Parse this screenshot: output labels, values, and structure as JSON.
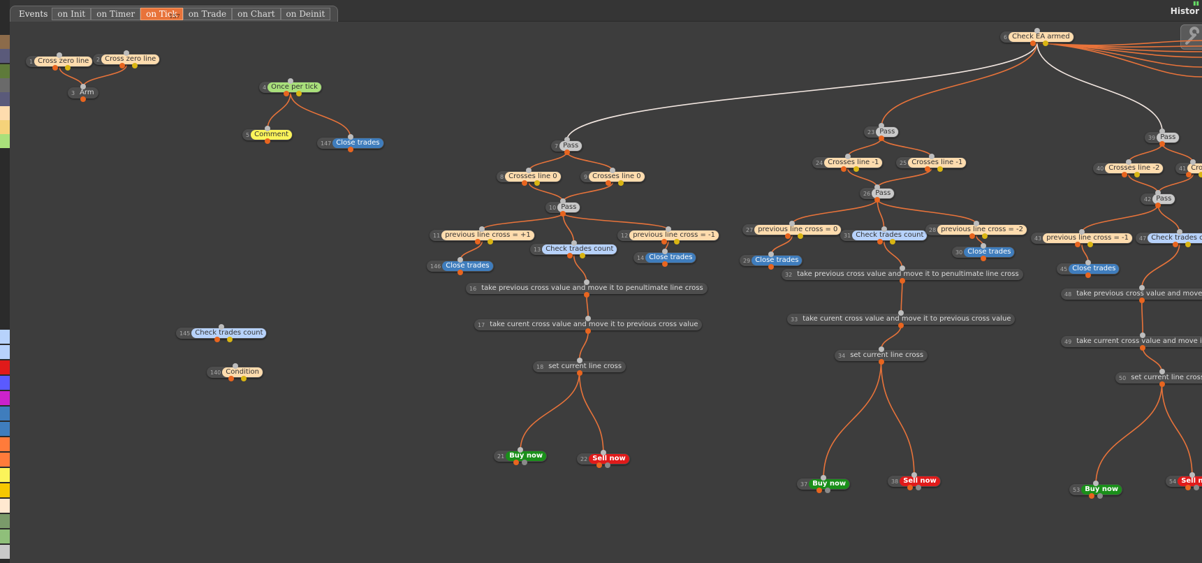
{
  "tabs": {
    "events_label": "Events",
    "items": [
      {
        "label": "on Init",
        "active": false
      },
      {
        "label": "on Timer",
        "active": false
      },
      {
        "label": "on Tick",
        "active": true,
        "badge": "157"
      },
      {
        "label": "on Trade",
        "active": false
      },
      {
        "label": "on Chart",
        "active": false
      },
      {
        "label": "on Deinit",
        "active": false
      }
    ]
  },
  "history_label": "Histor",
  "colors": {
    "link_orange": "#e8733a",
    "link_white": "#f2e6e0",
    "peach": "#fedcae",
    "blue": "#3f7dbd",
    "light_blue": "#b7d2fb",
    "green": "#a9e07b",
    "yellow": "#fbf45a",
    "buy": "#1a8f1a",
    "sell": "#e01a1a"
  },
  "palette": [
    "#8c6b4a",
    "#5a5a7a",
    "#5e7a3a",
    "#6a6a6a",
    "#5a5a7a",
    "#fedcae",
    "#f5d27a",
    "#a9e07b",
    "#b7d2fb",
    "#b7d2fb",
    "#e01a1a",
    "#5a5aff",
    "#cc22cc",
    "#3f7dbd",
    "#3f7dbd",
    "#ff7b3a",
    "#ff7b3a",
    "#fbf45a",
    "#f5c800",
    "#ffe8d0",
    "#7a9a6a",
    "#8fbf7a",
    "#c9c9c9"
  ],
  "nodes": [
    {
      "id": "1",
      "label": "Cross zero line",
      "type": "peach"
    },
    {
      "id": "2",
      "label": "Cross zero line",
      "type": "peach"
    },
    {
      "id": "3",
      "label": "Arm",
      "type": "darkgray"
    },
    {
      "id": "4",
      "label": "Once per tick",
      "type": "green"
    },
    {
      "id": "5",
      "label": "Comment",
      "type": "yellow"
    },
    {
      "id": "147",
      "label": "Close trades",
      "type": "blue"
    },
    {
      "id": "145",
      "label": "Check trades count",
      "type": "lightblue"
    },
    {
      "id": "140",
      "label": "Condition",
      "type": "peach"
    },
    {
      "id": "6",
      "label": "Check EA armed",
      "type": "peach"
    },
    {
      "id": "7",
      "label": "Pass",
      "type": "gray"
    },
    {
      "id": "8",
      "label": "Crosses line 0",
      "type": "peach"
    },
    {
      "id": "9",
      "label": "Crosses line 0",
      "type": "peach"
    },
    {
      "id": "10",
      "label": "Pass",
      "type": "gray"
    },
    {
      "id": "11",
      "label": "previous line cross = +1",
      "type": "peach"
    },
    {
      "id": "13",
      "label": "Check trades count",
      "type": "lightblue"
    },
    {
      "id": "12",
      "label": "previous line cross = -1",
      "type": "peach"
    },
    {
      "id": "146",
      "label": "Close trades",
      "type": "blue"
    },
    {
      "id": "14",
      "label": "Close trades",
      "type": "blue"
    },
    {
      "id": "16",
      "label": "take previous cross value and move it to penultimate line cross",
      "type": "darkgray"
    },
    {
      "id": "17",
      "label": "take curent cross value and move it to previous cross value",
      "type": "darkgray"
    },
    {
      "id": "18",
      "label": "set current line cross",
      "type": "darkgray"
    },
    {
      "id": "21",
      "label": "Buy now",
      "type": "buy"
    },
    {
      "id": "22",
      "label": "Sell now",
      "type": "sell"
    },
    {
      "id": "23",
      "label": "Pass",
      "type": "gray"
    },
    {
      "id": "24",
      "label": "Crosses line -1",
      "type": "peach"
    },
    {
      "id": "25",
      "label": "Crosses line -1",
      "type": "peach"
    },
    {
      "id": "26",
      "label": "Pass",
      "type": "gray"
    },
    {
      "id": "27",
      "label": "previous line cross = 0",
      "type": "peach"
    },
    {
      "id": "31",
      "label": "Check trades count",
      "type": "lightblue"
    },
    {
      "id": "28",
      "label": "previous line cross = -2",
      "type": "peach"
    },
    {
      "id": "29",
      "label": "Close trades",
      "type": "blue"
    },
    {
      "id": "30",
      "label": "Close trades",
      "type": "blue"
    },
    {
      "id": "32",
      "label": "take previous cross value and move it to penultimate line cross",
      "type": "darkgray"
    },
    {
      "id": "33",
      "label": "take curent cross value and move it to previous cross value",
      "type": "darkgray"
    },
    {
      "id": "34",
      "label": "set current line cross",
      "type": "darkgray"
    },
    {
      "id": "37",
      "label": "Buy now",
      "type": "buy"
    },
    {
      "id": "38",
      "label": "Sell now",
      "type": "sell"
    },
    {
      "id": "39",
      "label": "Pass",
      "type": "gray"
    },
    {
      "id": "40",
      "label": "Crosses line -2",
      "type": "peach"
    },
    {
      "id": "41",
      "label": "Cros",
      "type": "peach"
    },
    {
      "id": "42",
      "label": "Pass",
      "type": "gray"
    },
    {
      "id": "43",
      "label": "previous line cross = -1",
      "type": "peach"
    },
    {
      "id": "47",
      "label": "Check trades count",
      "type": "lightblue"
    },
    {
      "id": "45",
      "label": "Close trades",
      "type": "blue"
    },
    {
      "id": "48",
      "label": "take previous cross value and move it to",
      "type": "darkgray"
    },
    {
      "id": "49",
      "label": "take current cross value and move it to p",
      "type": "darkgray"
    },
    {
      "id": "50",
      "label": "set current line cross",
      "type": "darkgray"
    },
    {
      "id": "53",
      "label": "Buy now",
      "type": "buy"
    },
    {
      "id": "54",
      "label": "Sell now",
      "type": "sell"
    }
  ],
  "links": [
    [
      "1",
      "3"
    ],
    [
      "2",
      "3"
    ],
    [
      "4",
      "5"
    ],
    [
      "4",
      "147"
    ],
    [
      "6",
      "7"
    ],
    [
      "6",
      "23"
    ],
    [
      "6",
      "39"
    ],
    [
      "7",
      "8"
    ],
    [
      "7",
      "9"
    ],
    [
      "8",
      "10"
    ],
    [
      "9",
      "10"
    ],
    [
      "10",
      "11"
    ],
    [
      "10",
      "13"
    ],
    [
      "10",
      "12"
    ],
    [
      "11",
      "146"
    ],
    [
      "12",
      "14"
    ],
    [
      "13",
      "16"
    ],
    [
      "16",
      "17"
    ],
    [
      "17",
      "18"
    ],
    [
      "18",
      "21"
    ],
    [
      "18",
      "22"
    ],
    [
      "23",
      "24"
    ],
    [
      "23",
      "25"
    ],
    [
      "24",
      "26"
    ],
    [
      "25",
      "26"
    ],
    [
      "26",
      "27"
    ],
    [
      "26",
      "31"
    ],
    [
      "26",
      "28"
    ],
    [
      "27",
      "29"
    ],
    [
      "28",
      "30"
    ],
    [
      "31",
      "32"
    ],
    [
      "32",
      "33"
    ],
    [
      "33",
      "34"
    ],
    [
      "34",
      "37"
    ],
    [
      "34",
      "38"
    ],
    [
      "39",
      "40"
    ],
    [
      "39",
      "41"
    ],
    [
      "40",
      "42"
    ],
    [
      "41",
      "42"
    ],
    [
      "42",
      "43"
    ],
    [
      "42",
      "47"
    ],
    [
      "43",
      "45"
    ],
    [
      "47",
      "48"
    ],
    [
      "48",
      "49"
    ],
    [
      "49",
      "50"
    ],
    [
      "50",
      "53"
    ],
    [
      "50",
      "54"
    ]
  ]
}
